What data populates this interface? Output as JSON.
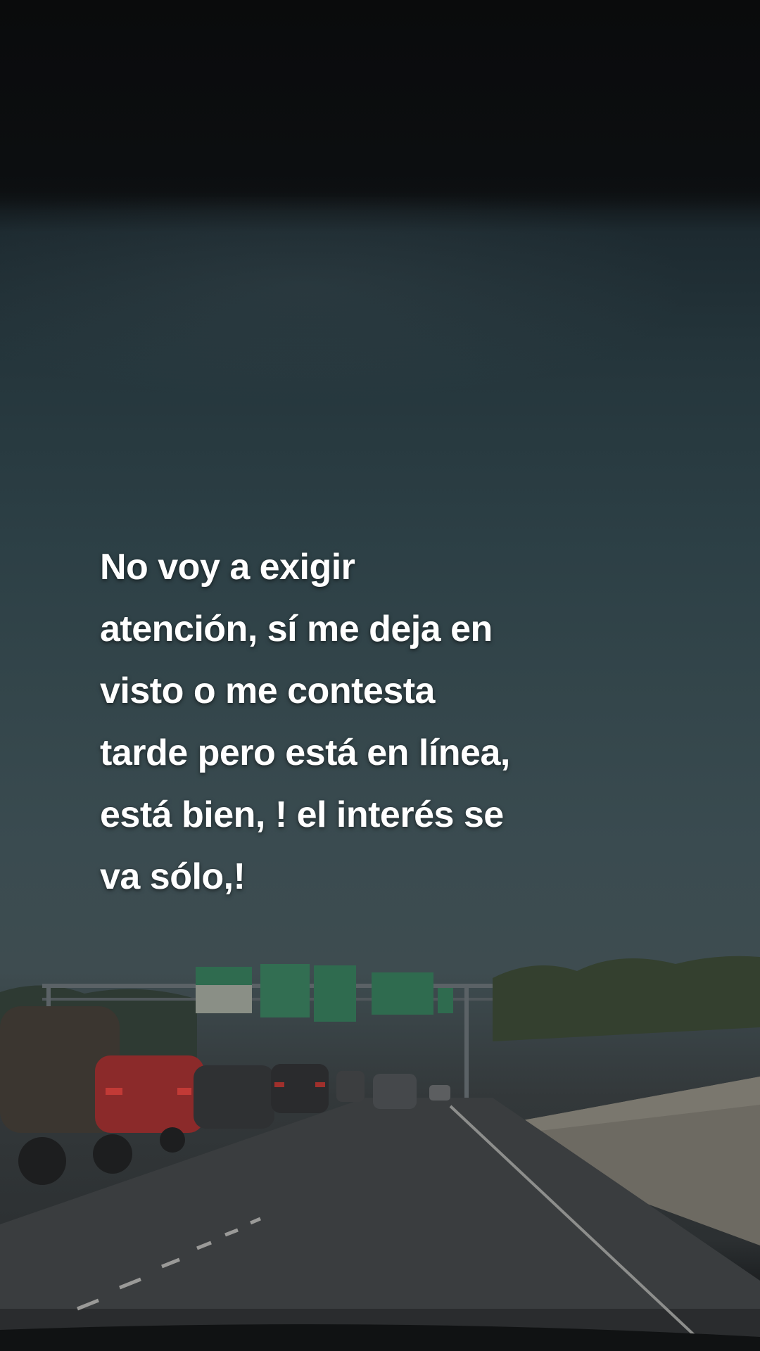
{
  "caption": {
    "lines": [
      "No voy a exigir",
      "atención, sí me deja en",
      "visto o me contesta",
      "tarde pero está en línea,",
      "está bien, ! el interés se",
      "va sólo,!"
    ]
  }
}
